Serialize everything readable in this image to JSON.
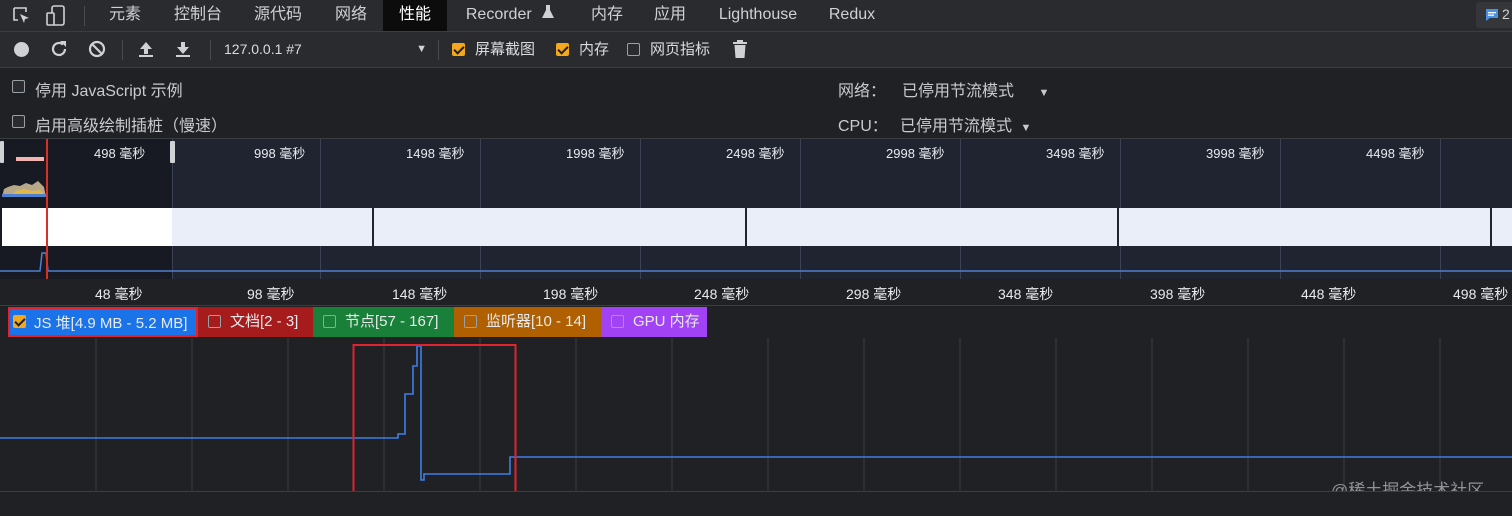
{
  "tabs": [
    "元素",
    "控制台",
    "源代码",
    "网络",
    "性能",
    "Recorder",
    "内存",
    "应用",
    "Lighthouse",
    "Redux"
  ],
  "active_tab": "性能",
  "issues_badge": "2",
  "toolbar": {
    "url": "127.0.0.1 #7",
    "screenshots_label": "屏幕截图",
    "screenshots_checked": true,
    "memory_label": "内存",
    "memory_checked": true,
    "web_vitals_label": "网页指标",
    "web_vitals_checked": false
  },
  "settings": {
    "disable_js_samples": "停用 JavaScript 示例",
    "advanced_paint": "启用高级绘制插桩（慢速）",
    "network_label": "网络：",
    "network_value": "已停用节流模式",
    "cpu_label": "CPU：",
    "cpu_value": "已停用节流模式"
  },
  "overview_ticks": [
    "498 毫秒",
    "998 毫秒",
    "1498 毫秒",
    "1998 毫秒",
    "2498 毫秒",
    "2998 毫秒",
    "3498 毫秒",
    "3998 毫秒",
    "4498 毫秒"
  ],
  "ruler_ticks": [
    "48 毫秒",
    "98 毫秒",
    "148 毫秒",
    "198 毫秒",
    "248 毫秒",
    "298 毫秒",
    "348 毫秒",
    "398 毫秒",
    "448 毫秒",
    "498 毫秒"
  ],
  "counters": [
    {
      "label": "JS 堆[4.9 MB - 5.2 MB]",
      "checked": true,
      "color": "#1a73e8"
    },
    {
      "label": "文档[2 - 3]",
      "checked": false,
      "color": "#a61c1c"
    },
    {
      "label": "节点[57 - 167]",
      "checked": false,
      "color": "#188038"
    },
    {
      "label": "监听器[10 - 14]",
      "checked": false,
      "color": "#b06000"
    },
    {
      "label": "GPU 内存",
      "checked": false,
      "color": "#a142f4"
    }
  ],
  "watermark": "@稀土掘金技术社区"
}
